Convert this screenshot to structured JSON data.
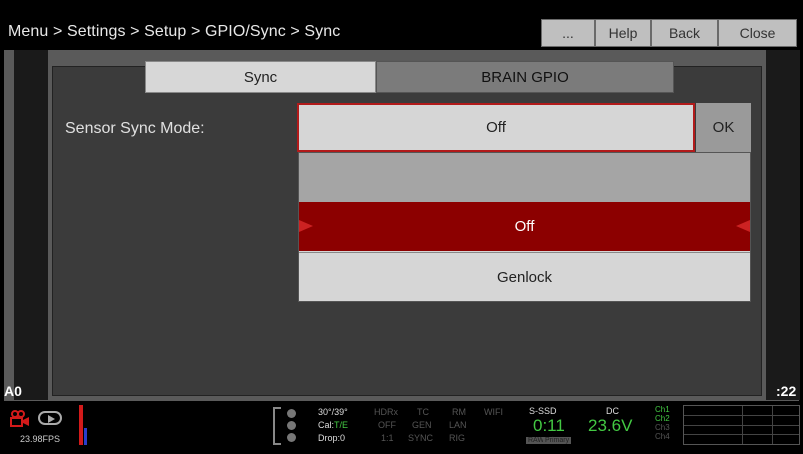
{
  "header": {
    "breadcrumb": "Menu > Settings > Setup > GPIO/Sync > Sync",
    "buttons": {
      "more": "...",
      "help": "Help",
      "back": "Back",
      "close": "Close"
    }
  },
  "tabs": [
    {
      "label": "Sync",
      "active": true
    },
    {
      "label": "BRAIN GPIO",
      "active": false
    }
  ],
  "setting": {
    "label": "Sensor Sync Mode:",
    "value": "Off",
    "ok": "OK",
    "options": [
      "Off",
      "Genlock"
    ],
    "selected": "Off"
  },
  "edge": {
    "left": "A0",
    "right": ":22"
  },
  "status": {
    "fps": "23.98FPS",
    "temp": "30°/39°",
    "cal": "Cal:",
    "cal_val": "T/E",
    "drop": "Drop:0",
    "col1": [
      "HDRx",
      "OFF",
      "1:1"
    ],
    "col2": [
      "TC",
      "GEN",
      "SYNC"
    ],
    "col3": [
      "RM",
      "LAN",
      "RIG"
    ],
    "wifi": "WIFI",
    "media_label": "S-SSD",
    "media_value": "0:11",
    "media_badges": [
      "RAW",
      "Primary"
    ],
    "power_label": "DC",
    "power_value": "23.6V",
    "channels": [
      "Ch1",
      "Ch2",
      "Ch3",
      "Ch4"
    ]
  },
  "colors": {
    "accent": "#8c0000",
    "status_green": "#43c943"
  }
}
